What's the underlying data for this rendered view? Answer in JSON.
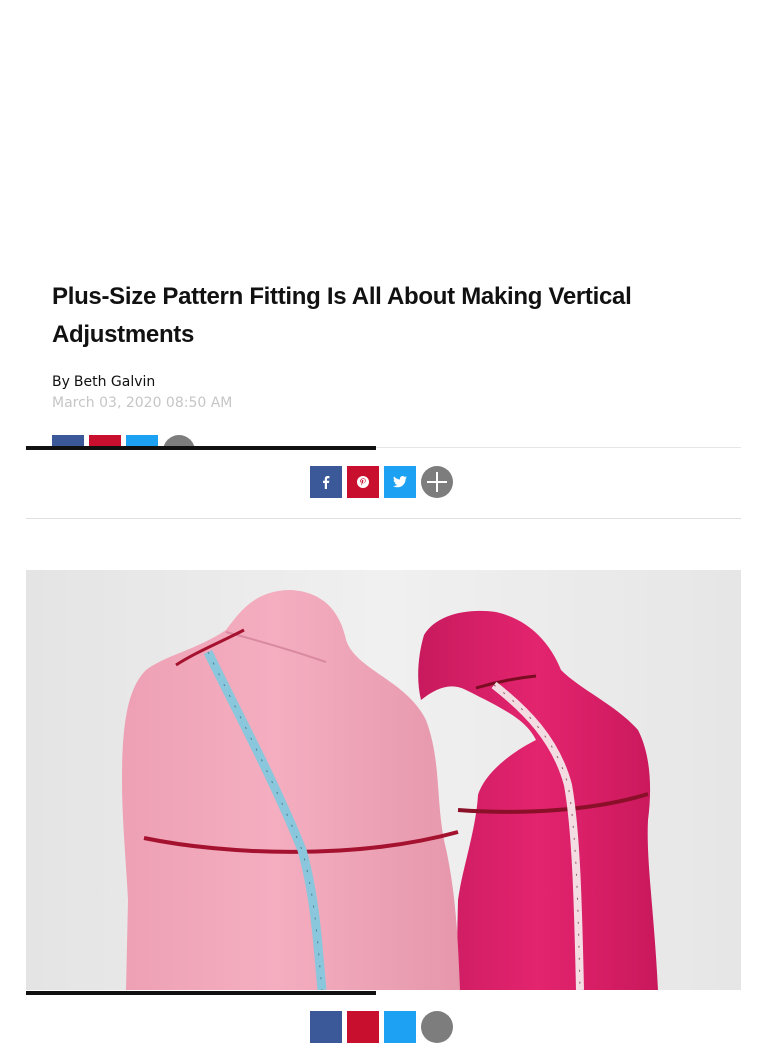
{
  "article": {
    "title": "Plus-Size Pattern Fitting Is All About Making Vertical Adjustments",
    "byline_prefix": "By",
    "author": "Beth Galvin",
    "date": "March 03, 2020 08:50 AM"
  },
  "share": {
    "buttons": [
      {
        "network": "facebook",
        "icon": "facebook-icon",
        "color": "#3b5998"
      },
      {
        "network": "pinterest",
        "icon": "pinterest-icon",
        "color": "#c8102e"
      },
      {
        "network": "twitter",
        "icon": "twitter-icon",
        "color": "#1da1f2"
      },
      {
        "network": "more",
        "icon": "plus-icon",
        "color": "#7d7d7d"
      }
    ]
  },
  "reading_progress": 0.49,
  "hero": {
    "image": "two-dress-forms-with-measuring-tapes"
  }
}
